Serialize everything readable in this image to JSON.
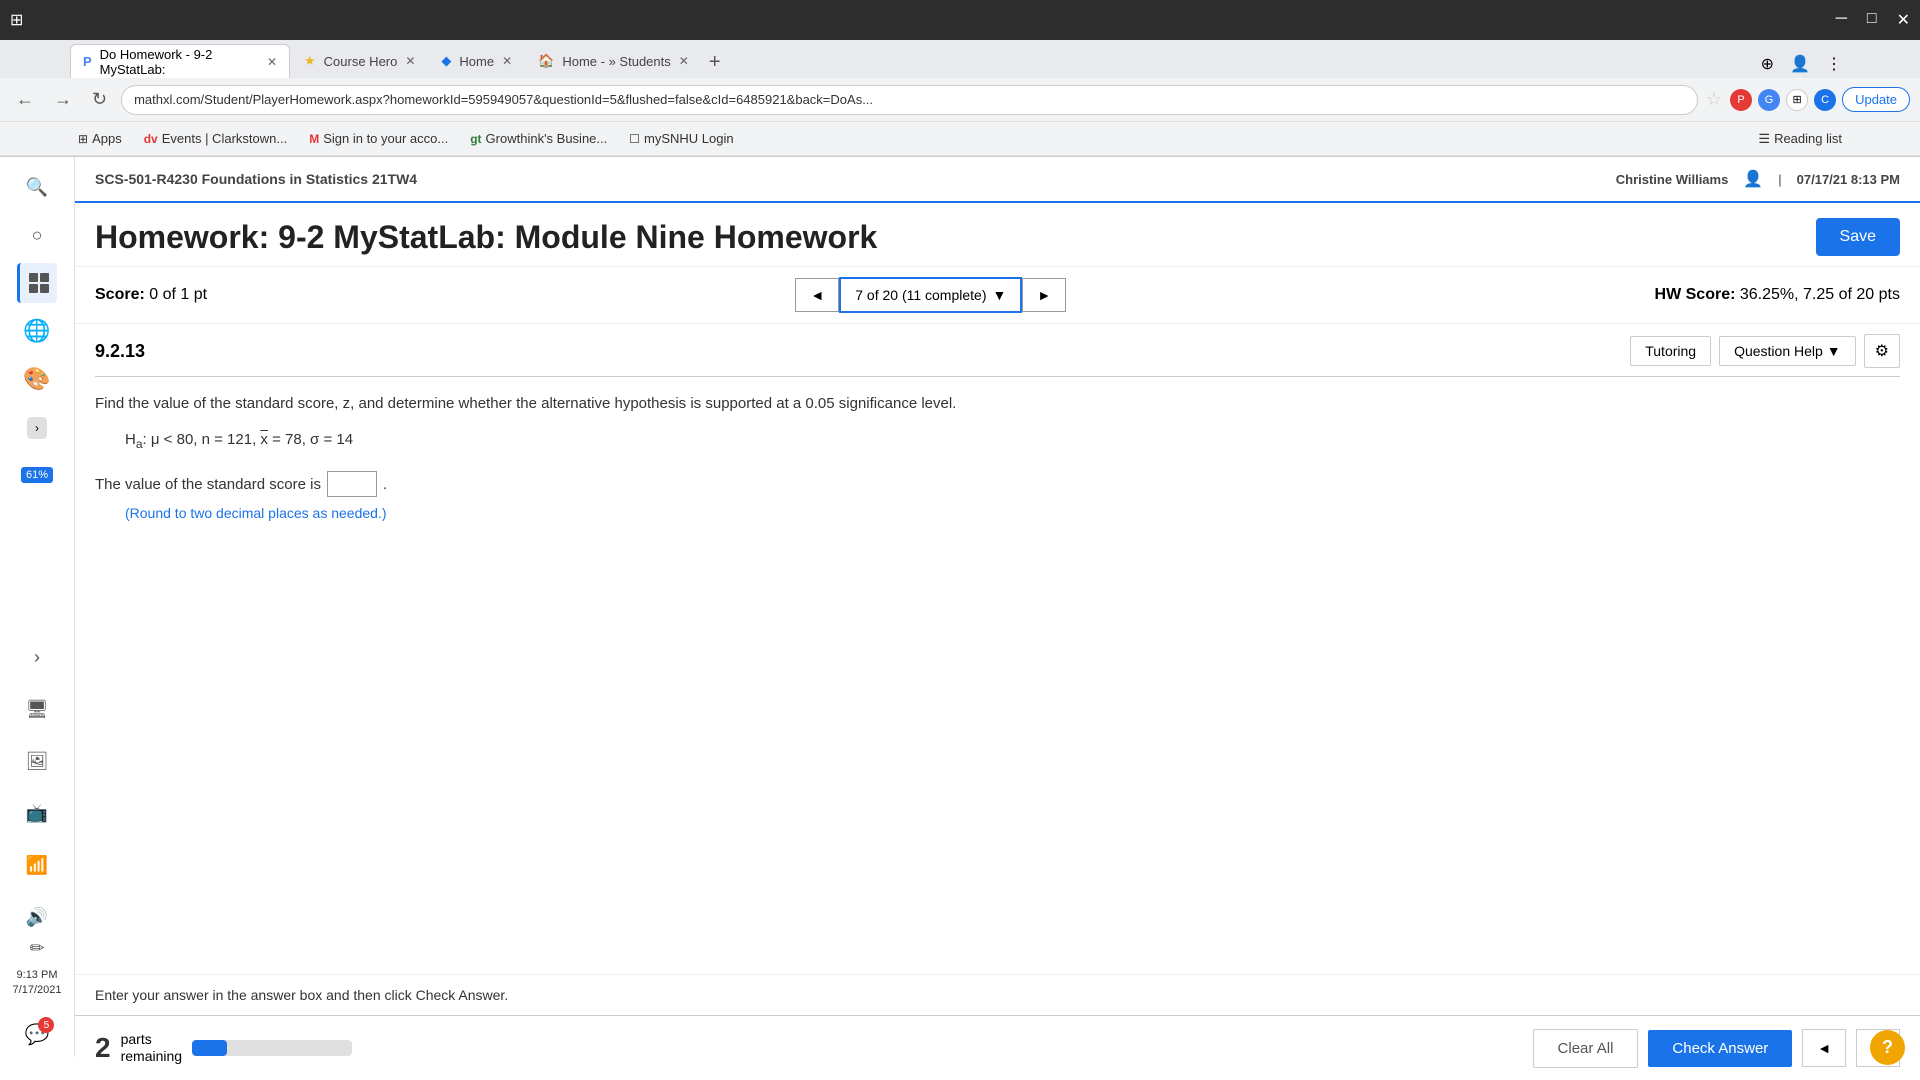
{
  "browser": {
    "tabs": [
      {
        "id": "tab1",
        "label": "Do Homework - 9-2 MyStatLab:",
        "active": true,
        "favicon": "P"
      },
      {
        "id": "tab2",
        "label": "Course Hero",
        "active": false,
        "favicon": "★"
      },
      {
        "id": "tab3",
        "label": "Home",
        "active": false,
        "favicon": "◆"
      },
      {
        "id": "tab4",
        "label": "Home - » Students",
        "active": false,
        "favicon": "🏠"
      }
    ],
    "address": "mathxl.com/Student/PlayerHomework.aspx?homeworkId=595949057&questionId=5&flushed=false&cId=6485921&back=DoAs...",
    "bookmarks": [
      {
        "label": "Apps",
        "icon": "⊞"
      },
      {
        "label": "Events | Clarkstown...",
        "icon": "dv"
      },
      {
        "label": "Sign in to your acco...",
        "icon": "M"
      },
      {
        "label": "Growthink's Busine...",
        "icon": "gt"
      },
      {
        "label": "mySNHU Login",
        "icon": "☐"
      }
    ],
    "reading_list": "Reading list",
    "update_btn": "Update"
  },
  "course_header": {
    "title": "SCS-501-R4230 Foundations in Statistics 21TW4",
    "user_name": "Christine Williams",
    "datetime": "07/17/21 8:13 PM",
    "separator": "|"
  },
  "homework": {
    "title": "Homework: 9-2 MyStatLab: Module Nine Homework",
    "save_label": "Save",
    "score_label": "Score:",
    "score_value": "0 of 1 pt",
    "question_nav": "7 of 20 (11 complete)",
    "hw_score_label": "HW Score:",
    "hw_score_value": "36.25%, 7.25 of 20 pts"
  },
  "question": {
    "number": "9.2.13",
    "tutoring_label": "Tutoring",
    "question_help_label": "Question Help",
    "question_text": "Find the value of the standard score, z, and determine whether the alternative hypothesis is supported at a 0.05 significance level.",
    "hypothesis": "H_a: μ < 80, n = 121, x̄ = 78, σ = 14",
    "answer_prefix": "The value of the standard score is",
    "answer_suffix": ".",
    "round_note": "(Round to two decimal places as needed.)"
  },
  "bottom": {
    "instruction": "Enter your answer in the answer box and then click Check Answer.",
    "parts_label": "parts",
    "parts_remaining_label": "remaining",
    "parts_num": "2",
    "clear_all_label": "Clear All",
    "check_answer_label": "Check Answer",
    "progress_pct": 22,
    "notification_count": "5"
  },
  "sidebar": {
    "time": "9:13 PM\n7/17/2021",
    "progress": "61%"
  }
}
